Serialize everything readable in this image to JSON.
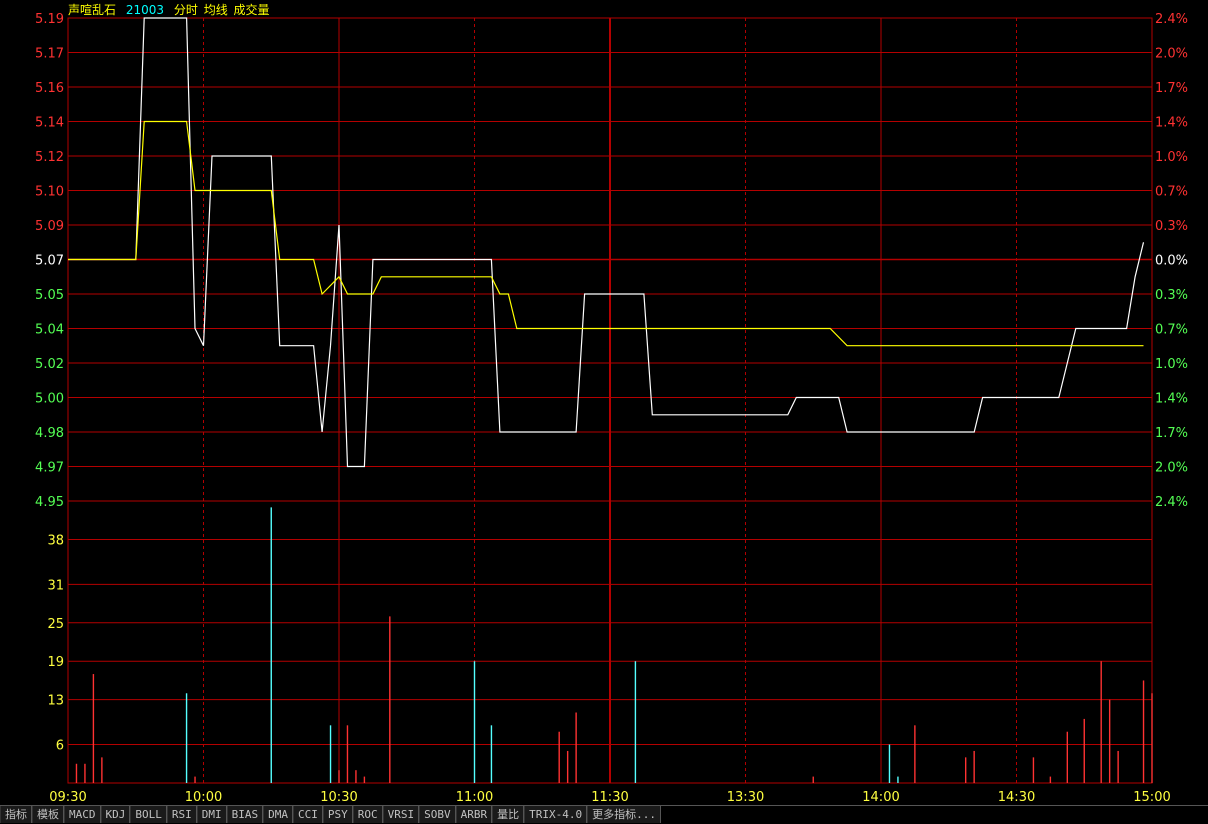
{
  "header": {
    "stock_name": "声喧乱石",
    "code": "21003",
    "items": [
      "分时",
      "均线",
      "成交量"
    ],
    "colors": {
      "name": "#ffff00",
      "code": "#00ffff",
      "items": "#ffff00"
    }
  },
  "colors": {
    "grid": "#b40000",
    "price_line": "#ffffff",
    "avg_line": "#ffff00",
    "up": "#ff3232",
    "down": "#54ff54",
    "flat": "#ffffff",
    "vol_up": "#ff3232",
    "vol_down": "#54ffff",
    "vol_label": "#ffff40",
    "time_label": "#ffff40"
  },
  "chart_data": {
    "type": "line",
    "x_range": [
      "09:30",
      "15:00"
    ],
    "prev_close": 5.07,
    "price_axis": {
      "left_labels": [
        "5.19",
        "5.17",
        "5.16",
        "5.14",
        "5.12",
        "5.10",
        "5.09",
        "5.07",
        "5.05",
        "5.04",
        "5.02",
        "5.00",
        "4.98",
        "4.97",
        "4.95"
      ],
      "right_labels": [
        "2.4%",
        "2.0%",
        "1.7%",
        "1.4%",
        "1.0%",
        "0.7%",
        "0.3%",
        "0.0%",
        "0.3%",
        "0.7%",
        "1.0%",
        "1.4%",
        "1.7%",
        "2.0%",
        "2.4%"
      ],
      "ylim": [
        4.95,
        5.19
      ]
    },
    "volume_axis": {
      "labels": [
        "38",
        "31",
        "25",
        "19",
        "13",
        "6"
      ],
      "ylim": [
        0,
        44
      ]
    },
    "time_labels": [
      "09:30",
      "10:00",
      "10:30",
      "11:00",
      "11:30",
      "13:30",
      "14:00",
      "14:30",
      "15:00"
    ],
    "series": [
      {
        "name": "分时",
        "points": [
          [
            0,
            5.07
          ],
          [
            8,
            5.07
          ],
          [
            9,
            5.19
          ],
          [
            14,
            5.19
          ],
          [
            15,
            5.04
          ],
          [
            16,
            5.03
          ],
          [
            17,
            5.12
          ],
          [
            24,
            5.12
          ],
          [
            25,
            5.03
          ],
          [
            29,
            5.03
          ],
          [
            30,
            4.98
          ],
          [
            31,
            5.03
          ],
          [
            32,
            5.09
          ],
          [
            33,
            4.97
          ],
          [
            35,
            4.97
          ],
          [
            36,
            5.07
          ],
          [
            50,
            5.07
          ],
          [
            51,
            4.98
          ],
          [
            52,
            4.98
          ],
          [
            53,
            4.98
          ],
          [
            60,
            4.98
          ],
          [
            61,
            5.05
          ],
          [
            68,
            5.05
          ],
          [
            69,
            4.99
          ],
          [
            85,
            4.99
          ],
          [
            86,
            5.0
          ],
          [
            91,
            5.0
          ],
          [
            92,
            4.98
          ],
          [
            107,
            4.98
          ],
          [
            108,
            5.0
          ],
          [
            117,
            5.0
          ],
          [
            118,
            5.02
          ],
          [
            119,
            5.04
          ],
          [
            125,
            5.04
          ],
          [
            126,
            5.06
          ],
          [
            127,
            5.08
          ]
        ]
      },
      {
        "name": "均线",
        "points": [
          [
            0,
            5.07
          ],
          [
            8,
            5.07
          ],
          [
            9,
            5.14
          ],
          [
            14,
            5.14
          ],
          [
            15,
            5.1
          ],
          [
            24,
            5.1
          ],
          [
            25,
            5.07
          ],
          [
            29,
            5.07
          ],
          [
            30,
            5.05
          ],
          [
            32,
            5.06
          ],
          [
            33,
            5.05
          ],
          [
            36,
            5.05
          ],
          [
            37,
            5.06
          ],
          [
            50,
            5.06
          ],
          [
            51,
            5.05
          ],
          [
            52,
            5.05
          ],
          [
            53,
            5.04
          ],
          [
            59,
            5.04
          ],
          [
            60,
            5.04
          ],
          [
            61,
            5.04
          ],
          [
            68,
            5.04
          ],
          [
            69,
            5.04
          ],
          [
            90,
            5.04
          ],
          [
            92,
            5.03
          ],
          [
            100,
            5.03
          ],
          [
            103,
            5.03
          ],
          [
            110,
            5.03
          ],
          [
            115,
            5.03
          ],
          [
            118,
            5.03
          ],
          [
            125,
            5.03
          ],
          [
            126,
            5.03
          ],
          [
            127,
            5.03
          ]
        ]
      }
    ],
    "volume": [
      {
        "t": 1,
        "v": 3,
        "dir": "up"
      },
      {
        "t": 2,
        "v": 3,
        "dir": "up"
      },
      {
        "t": 3,
        "v": 17,
        "dir": "up"
      },
      {
        "t": 4,
        "v": 4,
        "dir": "up"
      },
      {
        "t": 14,
        "v": 14,
        "dir": "down"
      },
      {
        "t": 15,
        "v": 1,
        "dir": "up"
      },
      {
        "t": 24,
        "v": 43,
        "dir": "down"
      },
      {
        "t": 31,
        "v": 9,
        "dir": "down"
      },
      {
        "t": 32,
        "v": 2,
        "dir": "up"
      },
      {
        "t": 33,
        "v": 9,
        "dir": "up"
      },
      {
        "t": 34,
        "v": 2,
        "dir": "up"
      },
      {
        "t": 35,
        "v": 1,
        "dir": "up"
      },
      {
        "t": 38,
        "v": 26,
        "dir": "up"
      },
      {
        "t": 48,
        "v": 19,
        "dir": "down"
      },
      {
        "t": 50,
        "v": 9,
        "dir": "down"
      },
      {
        "t": 58,
        "v": 8,
        "dir": "up"
      },
      {
        "t": 59,
        "v": 5,
        "dir": "up"
      },
      {
        "t": 60,
        "v": 11,
        "dir": "up"
      },
      {
        "t": 67,
        "v": 19,
        "dir": "down"
      },
      {
        "t": 88,
        "v": 1,
        "dir": "up"
      },
      {
        "t": 97,
        "v": 6,
        "dir": "down"
      },
      {
        "t": 98,
        "v": 1,
        "dir": "down"
      },
      {
        "t": 100,
        "v": 9,
        "dir": "up"
      },
      {
        "t": 106,
        "v": 4,
        "dir": "up"
      },
      {
        "t": 107,
        "v": 5,
        "dir": "up"
      },
      {
        "t": 114,
        "v": 4,
        "dir": "up"
      },
      {
        "t": 116,
        "v": 1,
        "dir": "up"
      },
      {
        "t": 118,
        "v": 8,
        "dir": "up"
      },
      {
        "t": 120,
        "v": 10,
        "dir": "up"
      },
      {
        "t": 122,
        "v": 19,
        "dir": "up"
      },
      {
        "t": 123,
        "v": 13,
        "dir": "up"
      },
      {
        "t": 124,
        "v": 5,
        "dir": "up"
      },
      {
        "t": 127,
        "v": 16,
        "dir": "up"
      },
      {
        "t": 128,
        "v": 14,
        "dir": "up"
      }
    ]
  },
  "tabs": [
    "指标",
    "模板",
    "MACD",
    "KDJ",
    "BOLL",
    "RSI",
    "DMI",
    "BIAS",
    "DMA",
    "CCI",
    "PSY",
    "ROC",
    "VRSI",
    "SOBV",
    "ARBR",
    "量比",
    "TRIX-4.0",
    "更多指标..."
  ]
}
